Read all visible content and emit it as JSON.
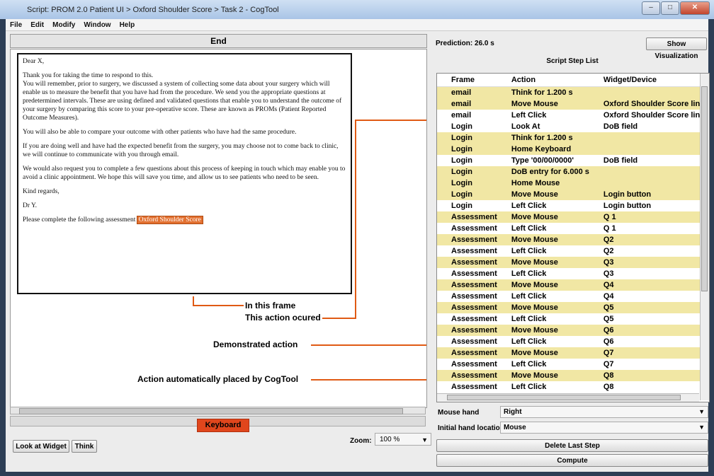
{
  "window": {
    "title": "Script: PROM 2.0 Patient UI > Oxford Shoulder Score > Task 2 - CogTool"
  },
  "menu": [
    "File",
    "Edit",
    "Modify",
    "Window",
    "Help"
  ],
  "frame": {
    "name": "End"
  },
  "email": {
    "greeting": "Dear X,",
    "p1": "Thank you for taking the time to respond to this.\nYou will remember, prior to surgery, we discussed a system of collecting some data about your surgery which will enable us to measure the benefit that you have had from the procedure. We send you the appropriate questions at predetermined intervals. These are using defined and validated questions that enable you to understand the outcome of your surgery by comparing this score to your pre-operative score. These are known as PROMs (Patient Reported Outcome Measures).",
    "p2": "You will also be able to compare your outcome with other patients who have had the same procedure.",
    "p3": "If you are doing well and have had the expected benefit from the surgery, you may choose not to come back to clinic, we will continue to communicate with you through email.",
    "p4": "We would also request you to complete a few questions about this process of keeping in touch which may enable you to avoid a clinic appointment. We hope this will save you time, and allow us to see patients who need to be seen.",
    "regards": "Kind regards,",
    "sign": "Dr Y.",
    "cta": "Please complete the following assessment",
    "link": "Oxford Shoulder Score"
  },
  "annotations": {
    "frame": "In this frame",
    "action": "This action ocured",
    "demo": "Demonstrated action",
    "auto": "Action automatically placed by CogTool"
  },
  "keyboard_label": "Keyboard",
  "zoom": {
    "label": "Zoom:",
    "value": "100 %"
  },
  "buttons": {
    "look": "Look at Widget",
    "think": "Think",
    "show_vis": "Show Visualization",
    "delete": "Delete Last Step",
    "compute": "Compute"
  },
  "prediction": "Prediction: 26.0 s",
  "script_title": "Script Step List",
  "columns": [
    "Frame",
    "Action",
    "Widget/Device"
  ],
  "steps": [
    {
      "frame": "email",
      "action": "Think for 1.200 s",
      "widget": "",
      "hl": true
    },
    {
      "frame": "email",
      "action": "Move Mouse",
      "widget": "Oxford Shoulder Score link",
      "hl": true
    },
    {
      "frame": "email",
      "action": "Left Click",
      "widget": "Oxford Shoulder Score link",
      "hl": false
    },
    {
      "frame": "Login",
      "action": "Look At",
      "widget": "DoB field",
      "hl": false
    },
    {
      "frame": "Login",
      "action": "Think for 1.200 s",
      "widget": "",
      "hl": true
    },
    {
      "frame": "Login",
      "action": "Home Keyboard",
      "widget": "",
      "hl": true
    },
    {
      "frame": "Login",
      "action": "Type '00/00/0000'",
      "widget": "DoB field",
      "hl": false
    },
    {
      "frame": "Login",
      "action": "DoB entry for 6.000 s",
      "widget": "",
      "hl": true
    },
    {
      "frame": "Login",
      "action": "Home Mouse",
      "widget": "",
      "hl": true
    },
    {
      "frame": "Login",
      "action": "Move Mouse",
      "widget": "Login button",
      "hl": true
    },
    {
      "frame": "Login",
      "action": "Left Click",
      "widget": "Login button",
      "hl": false
    },
    {
      "frame": "Assessment",
      "action": "Move Mouse",
      "widget": "Q 1",
      "hl": true
    },
    {
      "frame": "Assessment",
      "action": "Left Click",
      "widget": "Q 1",
      "hl": false
    },
    {
      "frame": "Assessment",
      "action": "Move Mouse",
      "widget": "Q2",
      "hl": true
    },
    {
      "frame": "Assessment",
      "action": "Left Click",
      "widget": "Q2",
      "hl": false
    },
    {
      "frame": "Assessment",
      "action": "Move Mouse",
      "widget": "Q3",
      "hl": true
    },
    {
      "frame": "Assessment",
      "action": "Left Click",
      "widget": "Q3",
      "hl": false
    },
    {
      "frame": "Assessment",
      "action": "Move Mouse",
      "widget": "Q4",
      "hl": true
    },
    {
      "frame": "Assessment",
      "action": "Left Click",
      "widget": "Q4",
      "hl": false
    },
    {
      "frame": "Assessment",
      "action": "Move Mouse",
      "widget": "Q5",
      "hl": true
    },
    {
      "frame": "Assessment",
      "action": "Left Click",
      "widget": "Q5",
      "hl": false
    },
    {
      "frame": "Assessment",
      "action": "Move Mouse",
      "widget": "Q6",
      "hl": true
    },
    {
      "frame": "Assessment",
      "action": "Left Click",
      "widget": "Q6",
      "hl": false
    },
    {
      "frame": "Assessment",
      "action": "Move Mouse",
      "widget": "Q7",
      "hl": true
    },
    {
      "frame": "Assessment",
      "action": "Left Click",
      "widget": "Q7",
      "hl": false
    },
    {
      "frame": "Assessment",
      "action": "Move Mouse",
      "widget": "Q8",
      "hl": true
    },
    {
      "frame": "Assessment",
      "action": "Left Click",
      "widget": "Q8",
      "hl": false
    }
  ],
  "mouse_hand": {
    "label": "Mouse hand",
    "value": "Right"
  },
  "initial_hand": {
    "label": "Initial hand location",
    "value": "Mouse"
  }
}
